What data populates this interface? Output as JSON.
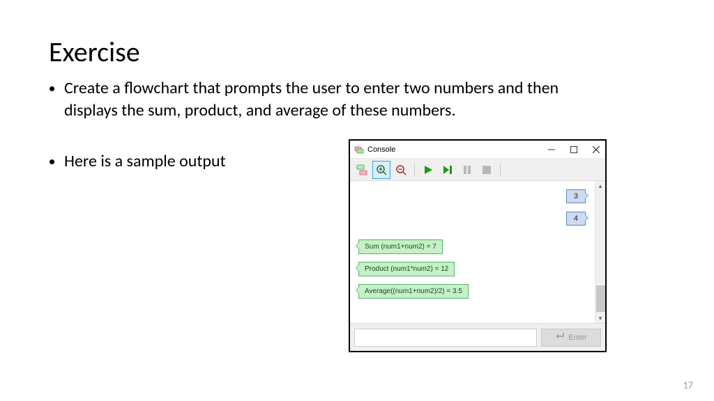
{
  "slide": {
    "title": "Exercise",
    "bullets": [
      "Create a flowchart that prompts the user to enter two numbers and then displays the sum, product, and average of these numbers.",
      "Here is a sample output"
    ],
    "page_number": "17"
  },
  "console": {
    "title": "Console",
    "enter_label": "Enter",
    "input_value": "",
    "user_inputs": [
      "3",
      "4"
    ],
    "outputs": [
      "Sum (num1+num2) = 7",
      "Product (num1*num2) = 12",
      "Average((num1+num2)/2) = 3.5"
    ]
  }
}
